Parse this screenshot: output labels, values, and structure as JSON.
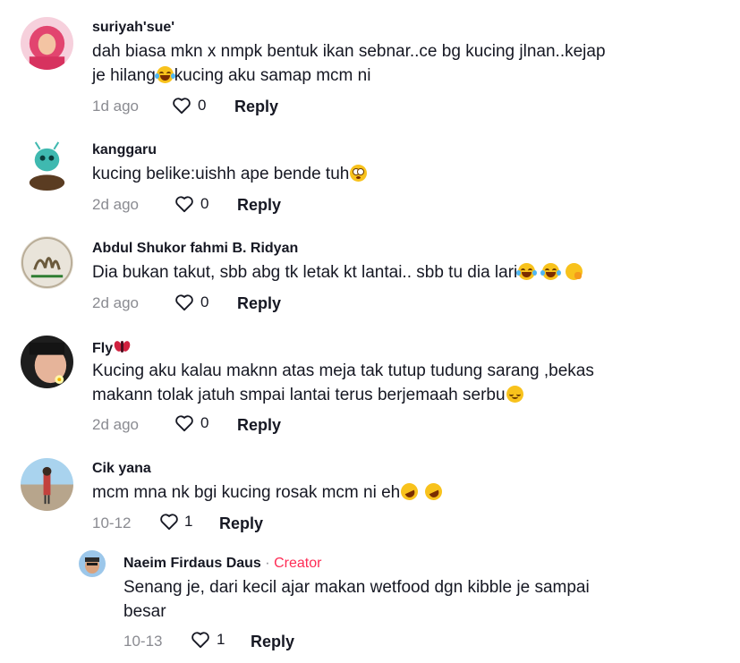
{
  "comments": [
    {
      "username": "suriyah'sue'",
      "text_parts": [
        {
          "t": "dah biasa mkn x nmpk bentuk ikan sebnar..ce bg kucing jlnan..kejap\nje hilang"
        },
        {
          "emoji": "laugh"
        },
        {
          "t": "kucing aku samap mcm ni"
        }
      ],
      "time": "1d ago",
      "likes": "0",
      "reply_label": "Reply",
      "avatar_icon": "woman-hijab-avatar"
    },
    {
      "username": "kanggaru",
      "text_parts": [
        {
          "t": "kucing belike:uishh ape bende tuh"
        },
        {
          "emoji": "flushed"
        }
      ],
      "time": "2d ago",
      "likes": "0",
      "reply_label": "Reply",
      "avatar_icon": "alien-figure-avatar"
    },
    {
      "username": "Abdul Shukor fahmi B. Ridyan",
      "text_parts": [
        {
          "t": "Dia bukan takut, sbb abg tk letak kt lantai.. sbb tu dia lari"
        },
        {
          "emoji": "laugh"
        },
        {
          "t": " "
        },
        {
          "emoji": "laugh"
        },
        {
          "t": " "
        },
        {
          "emoji": "shush"
        }
      ],
      "time": "2d ago",
      "likes": "0",
      "reply_label": "Reply",
      "avatar_icon": "calligraphy-avatar"
    },
    {
      "username": "Fly",
      "username_emoji": "butterfly",
      "text_parts": [
        {
          "t": "Kucing aku kalau maknn atas meja tak tutup tudung sarang ,bekas\nmakann tolak jatuh smpai lantai terus berjemaah serbu"
        },
        {
          "emoji": "relieved"
        }
      ],
      "time": "2d ago",
      "likes": "0",
      "reply_label": "Reply",
      "avatar_icon": "girl-flower-avatar"
    },
    {
      "username": "Cik yana",
      "text_parts": [
        {
          "t": "mcm mna nk bgi kucing rosak mcm ni eh"
        },
        {
          "emoji": "rofl"
        },
        {
          "t": " "
        },
        {
          "emoji": "rofl"
        }
      ],
      "time": "10-12",
      "likes": "1",
      "reply_label": "Reply",
      "avatar_icon": "beach-person-avatar"
    }
  ],
  "reply": {
    "username": "Naeim Firdaus Daus",
    "separator": "·",
    "badge": "Creator",
    "text": "Senang je, dari kecil ajar makan wetfood dgn kibble je sampai\nbesar",
    "time": "10-13",
    "likes": "1",
    "reply_label": "Reply",
    "avatar_icon": "man-selfie-avatar"
  },
  "colors": {
    "creator": "#fe2c55",
    "meta": "#8a8b91",
    "text": "#161823"
  }
}
